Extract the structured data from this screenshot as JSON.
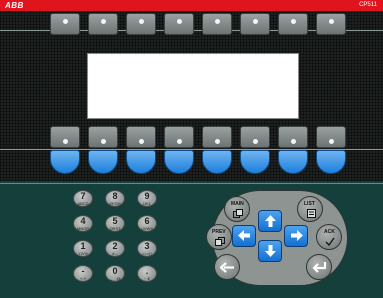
{
  "brand": {
    "logo": "ABB",
    "model": "CP511"
  },
  "colors": {
    "brand_red": "#e0141c",
    "soft_key_blue": "#1d7fdc",
    "panel_dark": "#143f3a"
  },
  "screen": {
    "state": "blank"
  },
  "function_keys_top": {
    "count": 8,
    "icon": "dot-icon"
  },
  "function_keys_bottom": {
    "count": 8,
    "icon": "dot-icon"
  },
  "soft_keys": {
    "count": 8
  },
  "keypad": [
    {
      "num": "7",
      "letters": "ABCD"
    },
    {
      "num": "8",
      "letters": "EFGH"
    },
    {
      "num": "9",
      "letters": "IJKL"
    },
    {
      "num": "4",
      "letters": "MNOP"
    },
    {
      "num": "5",
      "letters": "QRST"
    },
    {
      "num": "6",
      "letters": "UVWX"
    },
    {
      "num": "1",
      "letters": "YZ/%"
    },
    {
      "num": "2",
      "letters": "#,;:"
    },
    {
      "num": "3",
      "letters": "<=>()"
    },
    {
      "num": "-",
      "letters": "+-*/"
    },
    {
      "num": "0",
      "letters": "␣ _ @"
    },
    {
      "num": ".",
      "letters": "· ,€"
    }
  ],
  "nav": {
    "main": "MAIN",
    "list": "LIST",
    "prev": "PREV",
    "ack": "ACK",
    "icons": {
      "main": "pages-icon",
      "list": "list-icon",
      "prev": "prev-page-icon",
      "ack": "ack-icon",
      "up": "arrow-up-icon",
      "down": "arrow-down-icon",
      "left": "arrow-left-icon",
      "right": "arrow-right-icon",
      "back": "back-arrow-icon",
      "enter": "enter-icon"
    }
  }
}
